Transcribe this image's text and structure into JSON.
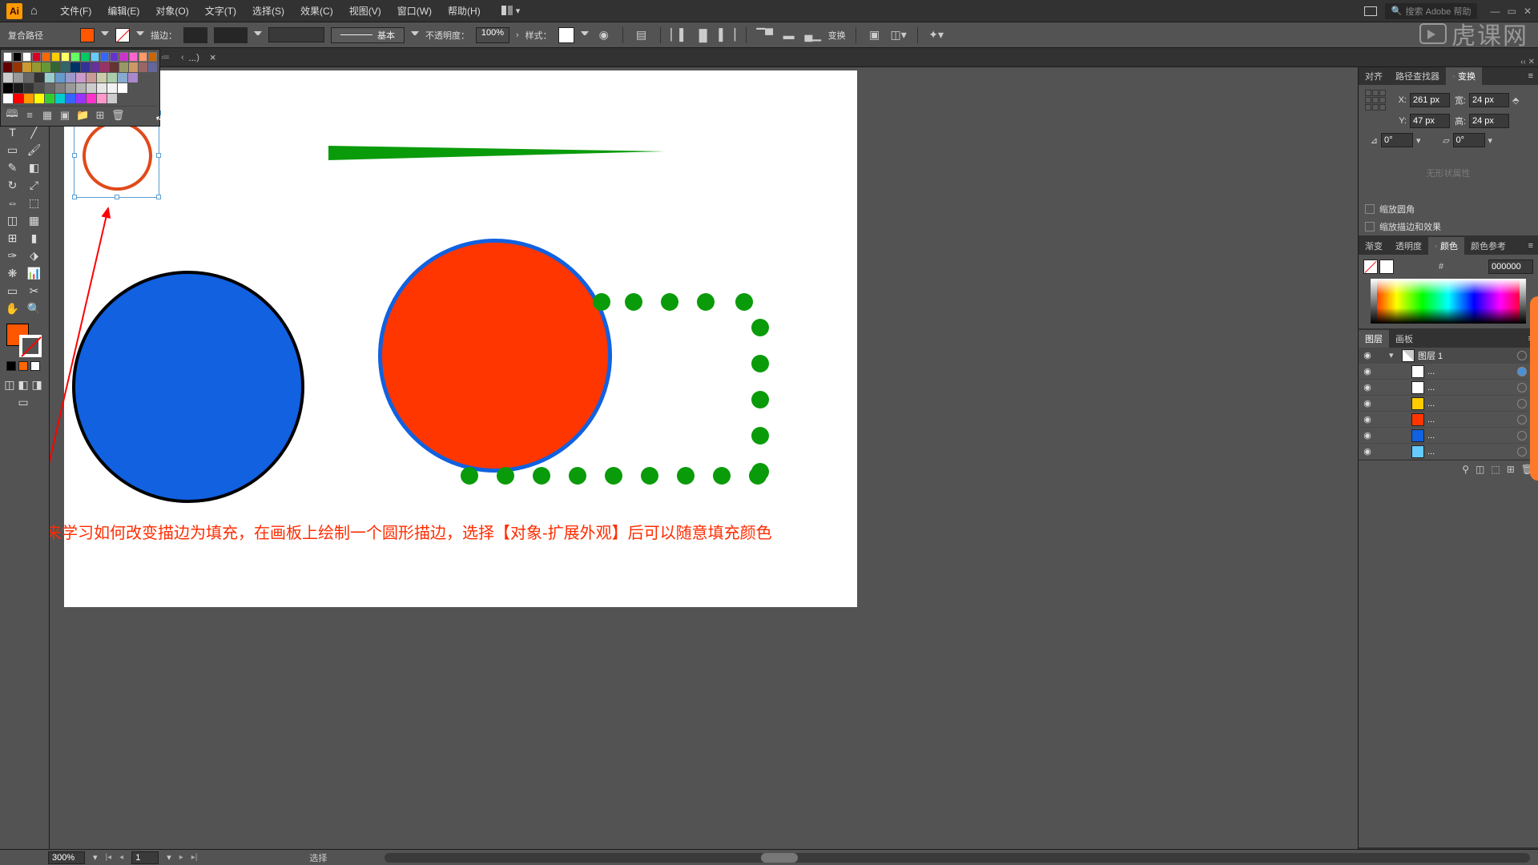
{
  "menubar": {
    "items": [
      "文件(F)",
      "编辑(E)",
      "对象(O)",
      "文字(T)",
      "选择(S)",
      "效果(C)",
      "视图(V)",
      "窗口(W)",
      "帮助(H)"
    ],
    "search_placeholder": "搜索 Adobe 帮助"
  },
  "controlbar": {
    "selection_label": "复合路径",
    "stroke_label": "描边：",
    "basic_brush": "基本",
    "opacity_label": "不透明度：",
    "opacity_value": "100%",
    "style_label": "样式：",
    "transform_label": "变换"
  },
  "doctab": {
    "name": "...）",
    "close": "×"
  },
  "swatch_colors": {
    "row1": [
      "#ffffff",
      "#000000",
      "#ffffff",
      "#d80027",
      "#ff6600",
      "#ffcc00",
      "#ffff66",
      "#66ff66",
      "#00cc66",
      "#66ccff",
      "#3366ff",
      "#6633cc",
      "#cc33cc",
      "#ff66cc",
      "#ff9966",
      "#cc6600"
    ],
    "row2": [
      "#660000",
      "#993300",
      "#cc9933",
      "#999933",
      "#669933",
      "#336633",
      "#336666",
      "#003366",
      "#333399",
      "#663399",
      "#993366",
      "#663333",
      "#999966",
      "#cc9966",
      "#996666",
      "#666699"
    ],
    "row3": [
      "#cccccc",
      "#999999",
      "#666666",
      "#333333",
      "#99cccc",
      "#6699cc",
      "#9999cc",
      "#cc99cc",
      "#cc9999",
      "#ccccaa",
      "#aaccaa",
      "#88aacc",
      "#aa88cc"
    ],
    "row4": [
      "#000000",
      "#1a1a1a",
      "#333333",
      "#4d4d4d",
      "#666666",
      "#808080",
      "#999999",
      "#b3b3b3",
      "#cccccc",
      "#e6e6e6",
      "#f2f2f2",
      "#ffffff"
    ],
    "row5": [
      "#ffffff",
      "#ff0000",
      "#ff9900",
      "#ffff00",
      "#33cc33",
      "#00cccc",
      "#3366ff",
      "#9933ff",
      "#ff33cc",
      "#ff99cc",
      "#cccccc"
    ]
  },
  "transform_panel": {
    "tabs": [
      "对齐",
      "路径查找器",
      "变换"
    ],
    "active_tab": "变换",
    "x_label": "X:",
    "x_value": "261 px",
    "y_label": "Y:",
    "y_value": "47 px",
    "w_label": "宽:",
    "w_value": "24 px",
    "h_label": "高:",
    "h_value": "24 px",
    "rot_label": "⊿",
    "rot_value": "0°",
    "shear_label": "✂",
    "shear_value": "0°",
    "dim_text": "无形状属性",
    "scale_corners": "缩放圆角",
    "scale_strokes": "缩放描边和效果"
  },
  "color_panel": {
    "tabs": [
      "渐变",
      "透明度",
      "颜色",
      "颜色参考"
    ],
    "active_tab": "颜色",
    "hex": "000000"
  },
  "layers_panel": {
    "tabs": [
      "图层",
      "画板"
    ],
    "active_tab": "图层",
    "layer_name": "图层 1",
    "items": [
      {
        "color": "#ffffff",
        "name": "..."
      },
      {
        "color": "#ffffff",
        "name": "..."
      },
      {
        "color": "#ffcc00",
        "name": "..."
      },
      {
        "color": "#ff3600",
        "name": "..."
      },
      {
        "color": "#1161e0",
        "name": "..."
      },
      {
        "color": "#66ccff",
        "name": "..."
      }
    ]
  },
  "canvas": {
    "instruction_text": "我们来学习如何改变描边为填充，在画板上绘制一个圆形描边，选择【对象-扩展外观】后可以随意填充颜色"
  },
  "statusbar": {
    "zoom": "300%",
    "artboard": "1",
    "status": "选择"
  },
  "watermark": "虎课网"
}
